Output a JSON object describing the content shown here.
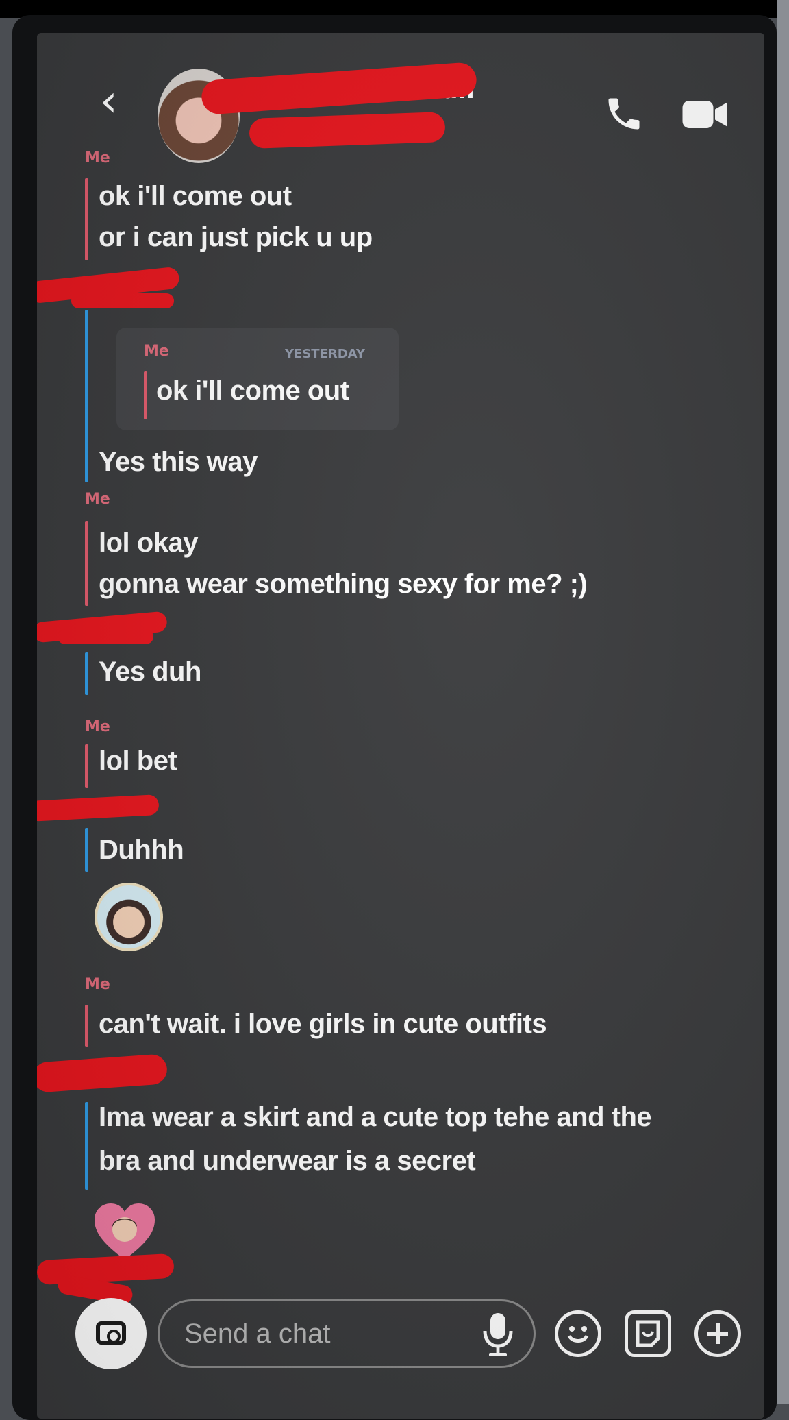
{
  "header": {
    "contact_name": "man",
    "contact_status": "1m"
  },
  "messages": [
    {
      "sender": "Me",
      "lines": [
        "ok i'll come out",
        "or i can just pick u up"
      ]
    },
    {
      "quote": {
        "sender": "Me",
        "date": "YESTERDAY",
        "text": "ok i'll come out"
      },
      "lines": [
        "Yes this way"
      ]
    },
    {
      "sender": "Me",
      "lines": [
        "lol okay",
        "gonna wear something sexy for me? ;)"
      ]
    },
    {
      "lines": [
        "Yes duh"
      ]
    },
    {
      "sender": "Me",
      "lines": [
        "lol bet"
      ]
    },
    {
      "lines": [
        "Duhhh"
      ]
    },
    {
      "sender": "Me",
      "lines": [
        "can't wait. i love girls in cute outfits"
      ]
    },
    {
      "lines": [
        "Ima wear a skirt and a cute top tehe and the",
        "bra and underwear is a secret"
      ]
    }
  ],
  "composer": {
    "placeholder": "Send a chat"
  },
  "colors": {
    "me_accent": "#e25a6c",
    "them_accent": "#2e9be6",
    "background": "#38393b"
  },
  "icons": [
    "back-icon",
    "call-icon",
    "video-call-icon",
    "camera-icon",
    "microphone-icon",
    "emoji-icon",
    "sticker-icon",
    "plus-icon"
  ]
}
